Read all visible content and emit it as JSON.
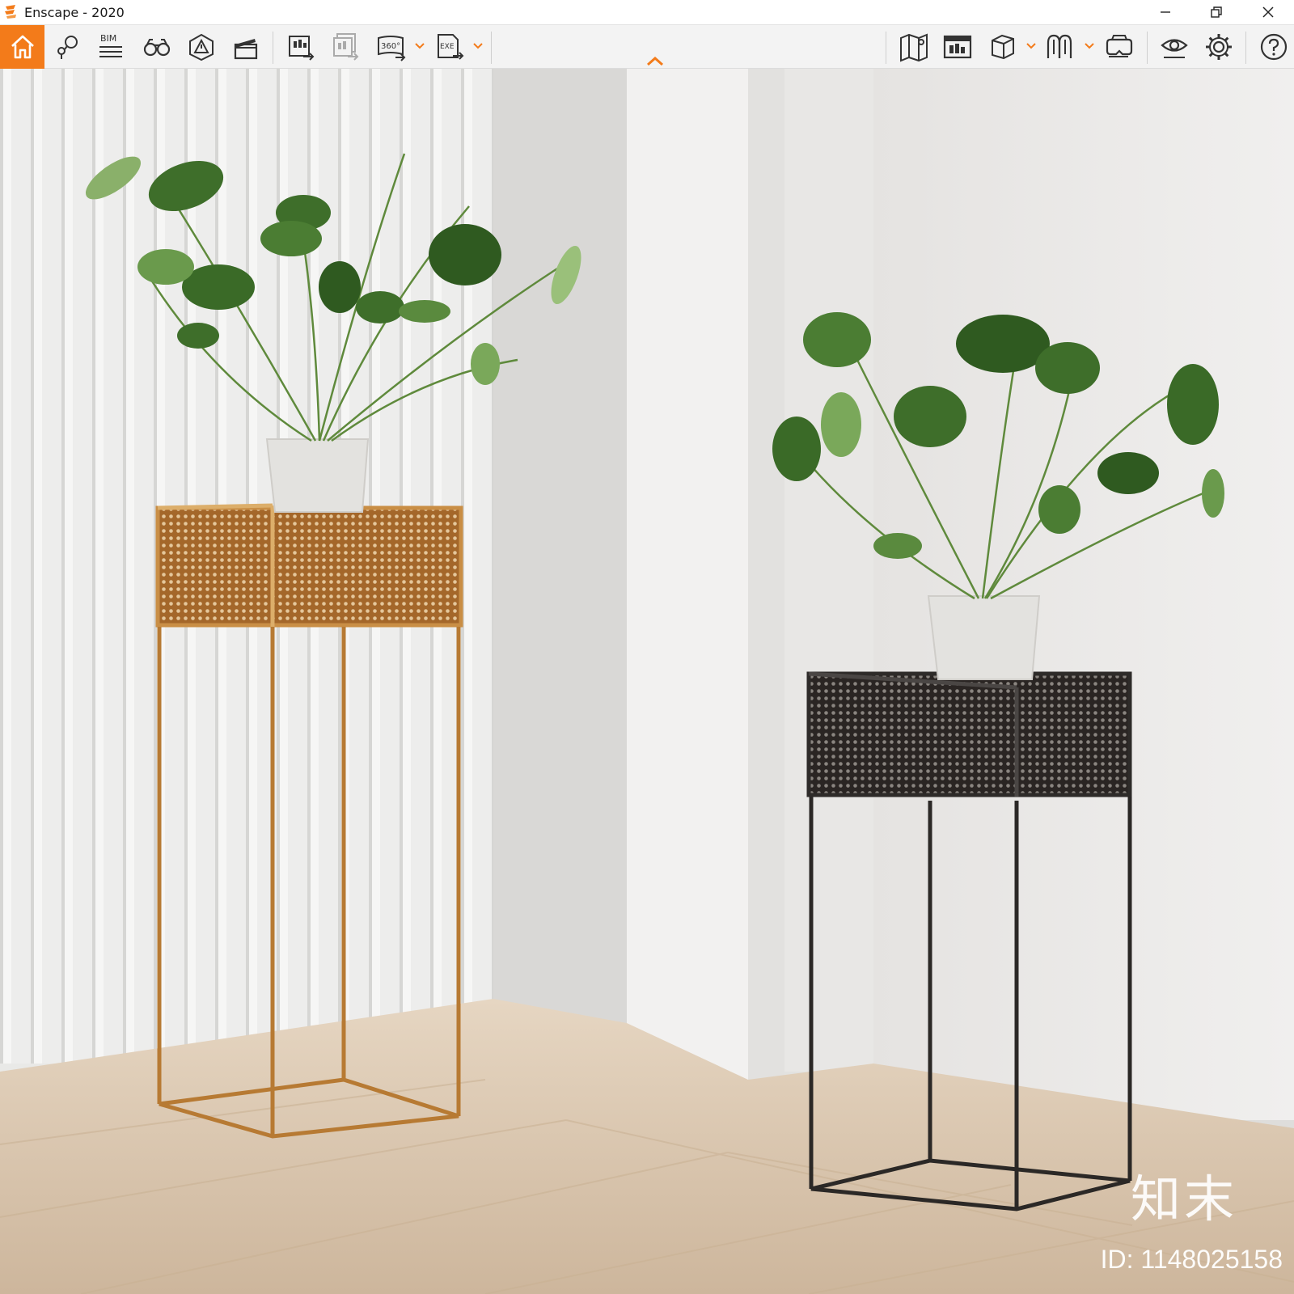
{
  "window": {
    "title": "Enscape - 2020",
    "controls": [
      "minimize",
      "restore",
      "close"
    ]
  },
  "toolbar": {
    "bim_label": "BIM",
    "panorama_label": "360°",
    "exe_label": "EXE",
    "accent_color": "#f37b1a",
    "left_icons": [
      "home-icon",
      "map-pin-icon",
      "bim-icon",
      "binoculars-icon",
      "alert-icon",
      "clapperboard-icon",
      "render-export-icon",
      "batch-render-icon",
      "panorama-360-icon",
      "exe-export-icon"
    ],
    "right_icons": [
      "map-icon",
      "screenshot-manager-icon",
      "cube-icon",
      "asset-library-icon",
      "vr-headset-icon",
      "visual-settings-icon",
      "settings-gear-icon",
      "help-icon"
    ]
  },
  "watermark": {
    "brand": "知末",
    "id_text": "ID: 1148025158"
  }
}
